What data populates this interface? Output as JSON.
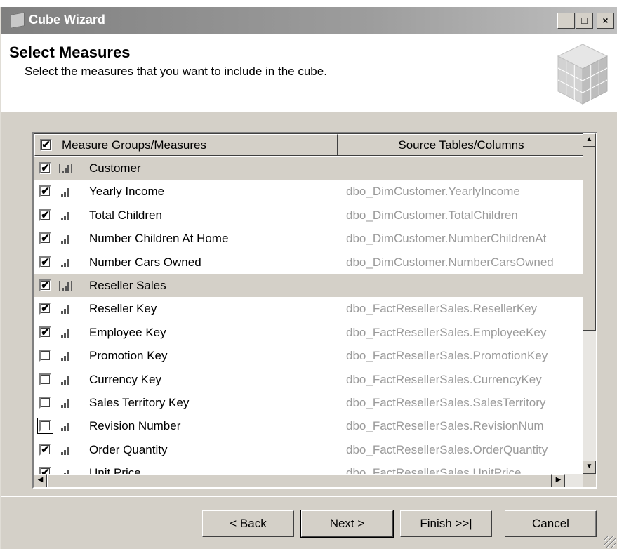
{
  "window": {
    "title": "Cube Wizard",
    "controls": {
      "minimize": "_",
      "maximize": "□",
      "close": "×"
    }
  },
  "header": {
    "title": "Select Measures",
    "description": "Select the measures that you want to include in the cube."
  },
  "tree": {
    "columns": {
      "measures": "Measure Groups/Measures",
      "source": "Source Tables/Columns"
    },
    "header_checked": true,
    "rows": [
      {
        "type": "group",
        "label": "Customer",
        "source": "",
        "checked": true
      },
      {
        "type": "measure",
        "label": "Yearly Income",
        "source": "dbo_DimCustomer.YearlyIncome",
        "checked": true
      },
      {
        "type": "measure",
        "label": "Total Children",
        "source": "dbo_DimCustomer.TotalChildren",
        "checked": true
      },
      {
        "type": "measure",
        "label": "Number Children At Home",
        "source": "dbo_DimCustomer.NumberChildrenAt",
        "checked": true
      },
      {
        "type": "measure",
        "label": "Number Cars Owned",
        "source": "dbo_DimCustomer.NumberCarsOwned",
        "checked": true
      },
      {
        "type": "group",
        "label": "Reseller Sales",
        "source": "",
        "checked": true
      },
      {
        "type": "measure",
        "label": "Reseller Key",
        "source": "dbo_FactResellerSales.ResellerKey",
        "checked": true
      },
      {
        "type": "measure",
        "label": "Employee Key",
        "source": "dbo_FactResellerSales.EmployeeKey",
        "checked": true
      },
      {
        "type": "measure",
        "label": "Promotion Key",
        "source": "dbo_FactResellerSales.PromotionKey",
        "checked": false
      },
      {
        "type": "measure",
        "label": "Currency Key",
        "source": "dbo_FactResellerSales.CurrencyKey",
        "checked": false
      },
      {
        "type": "measure",
        "label": "Sales Territory Key",
        "source": "dbo_FactResellerSales.SalesTerritory",
        "checked": false
      },
      {
        "type": "measure",
        "label": "Revision Number",
        "source": "dbo_FactResellerSales.RevisionNum",
        "checked": false,
        "focused": true
      },
      {
        "type": "measure",
        "label": "Order Quantity",
        "source": "dbo_FactResellerSales.OrderQuantity",
        "checked": true
      },
      {
        "type": "measure",
        "label": "Unit Price",
        "source": "dbo_FactResellerSales.UnitPrice",
        "checked": true
      }
    ]
  },
  "buttons": {
    "back": "< Back",
    "next": "Next >",
    "finish": "Finish >>|",
    "cancel": "Cancel"
  },
  "icons": {
    "app": "cube-icon",
    "checkmark": "✔",
    "measure": "bar-chart-icon"
  }
}
